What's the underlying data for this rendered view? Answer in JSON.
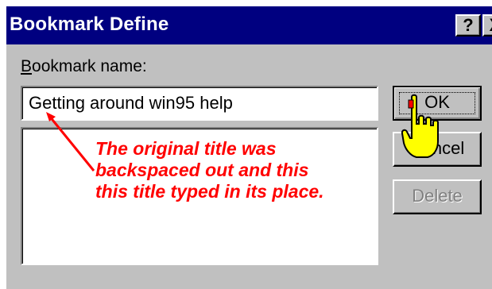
{
  "window": {
    "title": "Bookmark Define",
    "help_button": "?",
    "close_button": "X"
  },
  "form": {
    "name_label": "Bookmark name:",
    "name_label_mnemonic": "B",
    "name_label_rest": "ookmark name:",
    "name_value": "Getting around win95 help"
  },
  "buttons": {
    "ok": "OK",
    "cancel": "Cancel",
    "delete": "Delete",
    "delete_enabled": false
  },
  "annotation": {
    "lines": [
      "The original title was",
      "backspaced out and this",
      "this title typed in its place."
    ],
    "color": "#ff0000"
  },
  "colors": {
    "titlebar": "#000080",
    "face": "#c0c0c0",
    "cursor_hand": "#ffff00"
  },
  "icons": {
    "cursor": "hand-pointer-icon"
  }
}
